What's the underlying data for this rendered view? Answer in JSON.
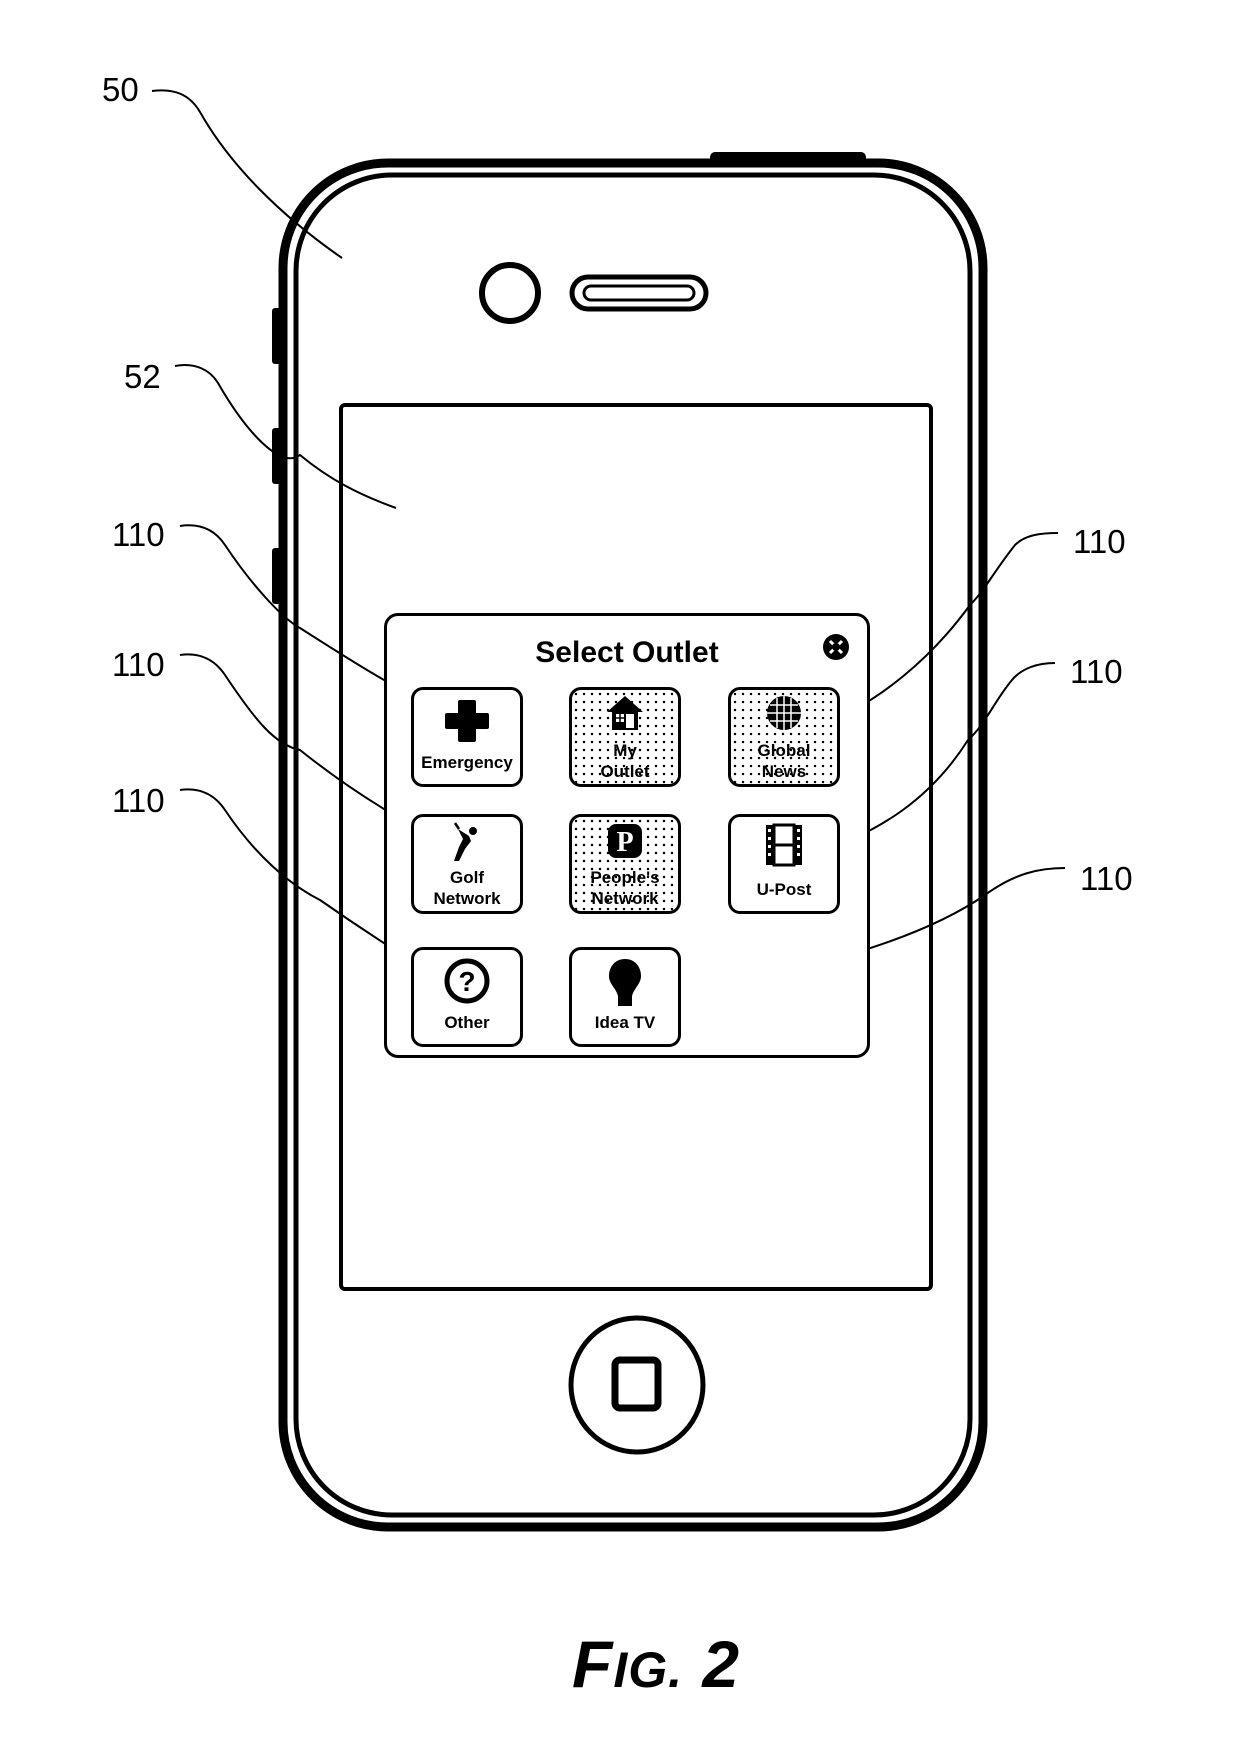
{
  "figure": {
    "caption_prefix": "F",
    "caption_small": "IG.",
    "caption_number": " 2"
  },
  "reference_numerals": {
    "device": "50",
    "screen": "52",
    "outlet_left_1": "110",
    "outlet_left_2": "110",
    "outlet_left_3": "110",
    "outlet_right_1": "110",
    "outlet_right_2": "110",
    "outlet_right_3": "110"
  },
  "dialog": {
    "title": "Select Outlet",
    "close_icon": "close-circle-icon",
    "tiles": [
      {
        "label_lines": [
          "Emergency"
        ],
        "icon": "medical-cross-icon",
        "shaded": false
      },
      {
        "label_lines": [
          "My",
          "Outlet"
        ],
        "icon": "house-icon",
        "shaded": true
      },
      {
        "label_lines": [
          "Global",
          "News"
        ],
        "icon": "globe-icon",
        "shaded": true
      },
      {
        "label_lines": [
          "Golf",
          "Network"
        ],
        "icon": "golfer-icon",
        "shaded": false
      },
      {
        "label_lines": [
          "People's",
          "Network"
        ],
        "icon": "p-badge-icon",
        "shaded": true
      },
      {
        "label_lines": [
          "U-Post"
        ],
        "icon": "film-strip-icon",
        "shaded": false
      },
      {
        "label_lines": [
          "Other"
        ],
        "icon": "question-circle-icon",
        "shaded": false
      },
      {
        "label_lines": [
          "Idea TV"
        ],
        "icon": "light-bulb-icon",
        "shaded": false
      }
    ]
  }
}
